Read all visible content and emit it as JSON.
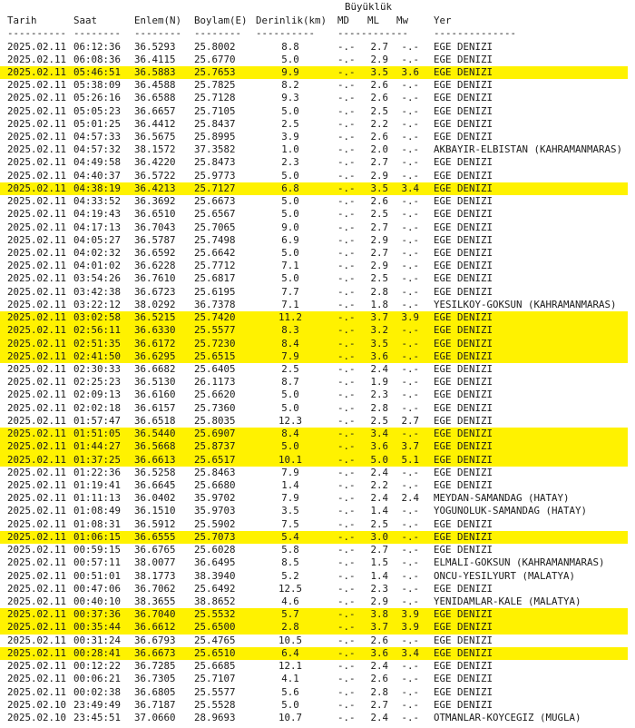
{
  "header": {
    "group_label": "Büyüklük",
    "date": "Tarih",
    "time": "Saat",
    "lat": "Enlem(N)",
    "lon": "Boylam(E)",
    "depth": "Derinlik(km)",
    "md": "MD",
    "ml": "ML",
    "mw": "Mw",
    "loc": "Yer"
  },
  "separators": {
    "date": "----------",
    "time": "--------",
    "lat": "--------",
    "lon": "--------",
    "depth": "----------",
    "mag": "------------",
    "loc": "--------------"
  },
  "highlight_color": "#fff200",
  "rows": [
    {
      "date": "2025.02.11",
      "time": "06:12:36",
      "lat": "36.5293",
      "lon": "25.8002",
      "depth": "8.8",
      "md": "-.-",
      "ml": "2.7",
      "mw": "-.-",
      "loc": "EGE DENIZI",
      "hl": false
    },
    {
      "date": "2025.02.11",
      "time": "06:08:36",
      "lat": "36.4115",
      "lon": "25.6770",
      "depth": "5.0",
      "md": "-.-",
      "ml": "2.9",
      "mw": "-.-",
      "loc": "EGE DENIZI",
      "hl": false
    },
    {
      "date": "2025.02.11",
      "time": "05:46:51",
      "lat": "36.5883",
      "lon": "25.7653",
      "depth": "9.9",
      "md": "-.-",
      "ml": "3.5",
      "mw": "3.6",
      "loc": "EGE DENIZI",
      "hl": true
    },
    {
      "date": "2025.02.11",
      "time": "05:38:09",
      "lat": "36.4588",
      "lon": "25.7825",
      "depth": "8.2",
      "md": "-.-",
      "ml": "2.6",
      "mw": "-.-",
      "loc": "EGE DENIZI",
      "hl": false
    },
    {
      "date": "2025.02.11",
      "time": "05:26:16",
      "lat": "36.6588",
      "lon": "25.7128",
      "depth": "9.3",
      "md": "-.-",
      "ml": "2.6",
      "mw": "-.-",
      "loc": "EGE DENIZI",
      "hl": false
    },
    {
      "date": "2025.02.11",
      "time": "05:05:23",
      "lat": "36.6657",
      "lon": "25.7105",
      "depth": "5.0",
      "md": "-.-",
      "ml": "2.5",
      "mw": "-.-",
      "loc": "EGE DENIZI",
      "hl": false
    },
    {
      "date": "2025.02.11",
      "time": "05:01:25",
      "lat": "36.4412",
      "lon": "25.8437",
      "depth": "2.5",
      "md": "-.-",
      "ml": "2.2",
      "mw": "-.-",
      "loc": "EGE DENIZI",
      "hl": false
    },
    {
      "date": "2025.02.11",
      "time": "04:57:33",
      "lat": "36.5675",
      "lon": "25.8995",
      "depth": "3.9",
      "md": "-.-",
      "ml": "2.6",
      "mw": "-.-",
      "loc": "EGE DENIZI",
      "hl": false
    },
    {
      "date": "2025.02.11",
      "time": "04:57:32",
      "lat": "38.1572",
      "lon": "37.3582",
      "depth": "1.0",
      "md": "-.-",
      "ml": "2.0",
      "mw": "-.-",
      "loc": "AKBAYIR-ELBISTAN (KAHRAMANMARAS)",
      "hl": false
    },
    {
      "date": "2025.02.11",
      "time": "04:49:58",
      "lat": "36.4220",
      "lon": "25.8473",
      "depth": "2.3",
      "md": "-.-",
      "ml": "2.7",
      "mw": "-.-",
      "loc": "EGE DENIZI",
      "hl": false
    },
    {
      "date": "2025.02.11",
      "time": "04:40:37",
      "lat": "36.5722",
      "lon": "25.9773",
      "depth": "5.0",
      "md": "-.-",
      "ml": "2.9",
      "mw": "-.-",
      "loc": "EGE DENIZI",
      "hl": false
    },
    {
      "date": "2025.02.11",
      "time": "04:38:19",
      "lat": "36.4213",
      "lon": "25.7127",
      "depth": "6.8",
      "md": "-.-",
      "ml": "3.5",
      "mw": "3.4",
      "loc": "EGE DENIZI",
      "hl": true
    },
    {
      "date": "2025.02.11",
      "time": "04:33:52",
      "lat": "36.3692",
      "lon": "25.6673",
      "depth": "5.0",
      "md": "-.-",
      "ml": "2.6",
      "mw": "-.-",
      "loc": "EGE DENIZI",
      "hl": false
    },
    {
      "date": "2025.02.11",
      "time": "04:19:43",
      "lat": "36.6510",
      "lon": "25.6567",
      "depth": "5.0",
      "md": "-.-",
      "ml": "2.5",
      "mw": "-.-",
      "loc": "EGE DENIZI",
      "hl": false
    },
    {
      "date": "2025.02.11",
      "time": "04:17:13",
      "lat": "36.7043",
      "lon": "25.7065",
      "depth": "9.0",
      "md": "-.-",
      "ml": "2.7",
      "mw": "-.-",
      "loc": "EGE DENIZI",
      "hl": false
    },
    {
      "date": "2025.02.11",
      "time": "04:05:27",
      "lat": "36.5787",
      "lon": "25.7498",
      "depth": "6.9",
      "md": "-.-",
      "ml": "2.9",
      "mw": "-.-",
      "loc": "EGE DENIZI",
      "hl": false
    },
    {
      "date": "2025.02.11",
      "time": "04:02:32",
      "lat": "36.6592",
      "lon": "25.6642",
      "depth": "5.0",
      "md": "-.-",
      "ml": "2.7",
      "mw": "-.-",
      "loc": "EGE DENIZI",
      "hl": false
    },
    {
      "date": "2025.02.11",
      "time": "04:01:02",
      "lat": "36.6228",
      "lon": "25.7712",
      "depth": "7.1",
      "md": "-.-",
      "ml": "2.9",
      "mw": "-.-",
      "loc": "EGE DENIZI",
      "hl": false
    },
    {
      "date": "2025.02.11",
      "time": "03:54:26",
      "lat": "36.7610",
      "lon": "25.6817",
      "depth": "5.0",
      "md": "-.-",
      "ml": "2.5",
      "mw": "-.-",
      "loc": "EGE DENIZI",
      "hl": false
    },
    {
      "date": "2025.02.11",
      "time": "03:42:38",
      "lat": "36.6723",
      "lon": "25.6195",
      "depth": "7.7",
      "md": "-.-",
      "ml": "2.8",
      "mw": "-.-",
      "loc": "EGE DENIZI",
      "hl": false
    },
    {
      "date": "2025.02.11",
      "time": "03:22:12",
      "lat": "38.0292",
      "lon": "36.7378",
      "depth": "7.1",
      "md": "-.-",
      "ml": "1.8",
      "mw": "-.-",
      "loc": "YESILKOY-GOKSUN (KAHRAMANMARAS)",
      "hl": false
    },
    {
      "date": "2025.02.11",
      "time": "03:02:58",
      "lat": "36.5215",
      "lon": "25.7420",
      "depth": "11.2",
      "md": "-.-",
      "ml": "3.7",
      "mw": "3.9",
      "loc": "EGE DENIZI",
      "hl": true
    },
    {
      "date": "2025.02.11",
      "time": "02:56:11",
      "lat": "36.6330",
      "lon": "25.5577",
      "depth": "8.3",
      "md": "-.-",
      "ml": "3.2",
      "mw": "-.-",
      "loc": "EGE DENIZI",
      "hl": true
    },
    {
      "date": "2025.02.11",
      "time": "02:51:35",
      "lat": "36.6172",
      "lon": "25.7230",
      "depth": "8.4",
      "md": "-.-",
      "ml": "3.5",
      "mw": "-.-",
      "loc": "EGE DENIZI",
      "hl": true
    },
    {
      "date": "2025.02.11",
      "time": "02:41:50",
      "lat": "36.6295",
      "lon": "25.6515",
      "depth": "7.9",
      "md": "-.-",
      "ml": "3.6",
      "mw": "-.-",
      "loc": "EGE DENIZI",
      "hl": true
    },
    {
      "date": "2025.02.11",
      "time": "02:30:33",
      "lat": "36.6682",
      "lon": "25.6405",
      "depth": "2.5",
      "md": "-.-",
      "ml": "2.4",
      "mw": "-.-",
      "loc": "EGE DENIZI",
      "hl": false
    },
    {
      "date": "2025.02.11",
      "time": "02:25:23",
      "lat": "36.5130",
      "lon": "26.1173",
      "depth": "8.7",
      "md": "-.-",
      "ml": "1.9",
      "mw": "-.-",
      "loc": "EGE DENIZI",
      "hl": false
    },
    {
      "date": "2025.02.11",
      "time": "02:09:13",
      "lat": "36.6160",
      "lon": "25.6620",
      "depth": "5.0",
      "md": "-.-",
      "ml": "2.3",
      "mw": "-.-",
      "loc": "EGE DENIZI",
      "hl": false
    },
    {
      "date": "2025.02.11",
      "time": "02:02:18",
      "lat": "36.6157",
      "lon": "25.7360",
      "depth": "5.0",
      "md": "-.-",
      "ml": "2.8",
      "mw": "-.-",
      "loc": "EGE DENIZI",
      "hl": false
    },
    {
      "date": "2025.02.11",
      "time": "01:57:47",
      "lat": "36.6518",
      "lon": "25.8035",
      "depth": "12.3",
      "md": "-.-",
      "ml": "2.5",
      "mw": "2.7",
      "loc": "EGE DENIZI",
      "hl": false
    },
    {
      "date": "2025.02.11",
      "time": "01:51:05",
      "lat": "36.5440",
      "lon": "25.6907",
      "depth": "8.4",
      "md": "-.-",
      "ml": "3.4",
      "mw": "-.-",
      "loc": "EGE DENIZI",
      "hl": true
    },
    {
      "date": "2025.02.11",
      "time": "01:44:27",
      "lat": "36.5668",
      "lon": "25.8737",
      "depth": "5.0",
      "md": "-.-",
      "ml": "3.6",
      "mw": "3.7",
      "loc": "EGE DENIZI",
      "hl": true
    },
    {
      "date": "2025.02.11",
      "time": "01:37:25",
      "lat": "36.6613",
      "lon": "25.6517",
      "depth": "10.1",
      "md": "-.-",
      "ml": "5.0",
      "mw": "5.1",
      "loc": "EGE DENIZI",
      "hl": true
    },
    {
      "date": "2025.02.11",
      "time": "01:22:36",
      "lat": "36.5258",
      "lon": "25.8463",
      "depth": "7.9",
      "md": "-.-",
      "ml": "2.4",
      "mw": "-.-",
      "loc": "EGE DENIZI",
      "hl": false
    },
    {
      "date": "2025.02.11",
      "time": "01:19:41",
      "lat": "36.6645",
      "lon": "25.6680",
      "depth": "1.4",
      "md": "-.-",
      "ml": "2.2",
      "mw": "-.-",
      "loc": "EGE DENIZI",
      "hl": false
    },
    {
      "date": "2025.02.11",
      "time": "01:11:13",
      "lat": "36.0402",
      "lon": "35.9702",
      "depth": "7.9",
      "md": "-.-",
      "ml": "2.4",
      "mw": "2.4",
      "loc": "MEYDAN-SAMANDAG (HATAY)",
      "hl": false
    },
    {
      "date": "2025.02.11",
      "time": "01:08:49",
      "lat": "36.1510",
      "lon": "35.9703",
      "depth": "3.5",
      "md": "-.-",
      "ml": "1.4",
      "mw": "-.-",
      "loc": "YOGUNOLUK-SAMANDAG (HATAY)",
      "hl": false
    },
    {
      "date": "2025.02.11",
      "time": "01:08:31",
      "lat": "36.5912",
      "lon": "25.5902",
      "depth": "7.5",
      "md": "-.-",
      "ml": "2.5",
      "mw": "-.-",
      "loc": "EGE DENIZI",
      "hl": false
    },
    {
      "date": "2025.02.11",
      "time": "01:06:15",
      "lat": "36.6555",
      "lon": "25.7073",
      "depth": "5.4",
      "md": "-.-",
      "ml": "3.0",
      "mw": "-.-",
      "loc": "EGE DENIZI",
      "hl": true
    },
    {
      "date": "2025.02.11",
      "time": "00:59:15",
      "lat": "36.6765",
      "lon": "25.6028",
      "depth": "5.8",
      "md": "-.-",
      "ml": "2.7",
      "mw": "-.-",
      "loc": "EGE DENIZI",
      "hl": false
    },
    {
      "date": "2025.02.11",
      "time": "00:57:11",
      "lat": "38.0077",
      "lon": "36.6495",
      "depth": "8.5",
      "md": "-.-",
      "ml": "1.5",
      "mw": "-.-",
      "loc": "ELMALI-GOKSUN (KAHRAMANMARAS)",
      "hl": false
    },
    {
      "date": "2025.02.11",
      "time": "00:51:01",
      "lat": "38.1773",
      "lon": "38.3940",
      "depth": "5.2",
      "md": "-.-",
      "ml": "1.4",
      "mw": "-.-",
      "loc": "ONCU-YESILYURT (MALATYA)",
      "hl": false
    },
    {
      "date": "2025.02.11",
      "time": "00:47:06",
      "lat": "36.7062",
      "lon": "25.6492",
      "depth": "12.5",
      "md": "-.-",
      "ml": "2.3",
      "mw": "-.-",
      "loc": "EGE DENIZI",
      "hl": false
    },
    {
      "date": "2025.02.11",
      "time": "00:40:10",
      "lat": "38.3655",
      "lon": "38.8652",
      "depth": "4.6",
      "md": "-.-",
      "ml": "2.9",
      "mw": "-.-",
      "loc": "YENIDAMLAR-KALE (MALATYA)",
      "hl": false
    },
    {
      "date": "2025.02.11",
      "time": "00:37:36",
      "lat": "36.7040",
      "lon": "25.5532",
      "depth": "5.7",
      "md": "-.-",
      "ml": "3.8",
      "mw": "3.9",
      "loc": "EGE DENIZI",
      "hl": true
    },
    {
      "date": "2025.02.11",
      "time": "00:35:44",
      "lat": "36.6612",
      "lon": "25.6500",
      "depth": "2.8",
      "md": "-.-",
      "ml": "3.7",
      "mw": "3.9",
      "loc": "EGE DENIZI",
      "hl": true
    },
    {
      "date": "2025.02.11",
      "time": "00:31:24",
      "lat": "36.6793",
      "lon": "25.4765",
      "depth": "10.5",
      "md": "-.-",
      "ml": "2.6",
      "mw": "-.-",
      "loc": "EGE DENIZI",
      "hl": false
    },
    {
      "date": "2025.02.11",
      "time": "00:28:41",
      "lat": "36.6673",
      "lon": "25.6510",
      "depth": "6.4",
      "md": "-.-",
      "ml": "3.6",
      "mw": "3.4",
      "loc": "EGE DENIZI",
      "hl": true
    },
    {
      "date": "2025.02.11",
      "time": "00:12:22",
      "lat": "36.7285",
      "lon": "25.6685",
      "depth": "12.1",
      "md": "-.-",
      "ml": "2.4",
      "mw": "-.-",
      "loc": "EGE DENIZI",
      "hl": false
    },
    {
      "date": "2025.02.11",
      "time": "00:06:21",
      "lat": "36.7305",
      "lon": "25.7107",
      "depth": "4.1",
      "md": "-.-",
      "ml": "2.6",
      "mw": "-.-",
      "loc": "EGE DENIZI",
      "hl": false
    },
    {
      "date": "2025.02.11",
      "time": "00:02:38",
      "lat": "36.6805",
      "lon": "25.5577",
      "depth": "5.6",
      "md": "-.-",
      "ml": "2.8",
      "mw": "-.-",
      "loc": "EGE DENIZI",
      "hl": false
    },
    {
      "date": "2025.02.10",
      "time": "23:49:49",
      "lat": "36.7187",
      "lon": "25.5528",
      "depth": "5.0",
      "md": "-.-",
      "ml": "2.7",
      "mw": "-.-",
      "loc": "EGE DENIZI",
      "hl": false
    },
    {
      "date": "2025.02.10",
      "time": "23:45:51",
      "lat": "37.0660",
      "lon": "28.9693",
      "depth": "10.7",
      "md": "-.-",
      "ml": "2.4",
      "mw": "-.-",
      "loc": "OTMANLAR-KOYCEGIZ (MUGLA)",
      "hl": false
    }
  ]
}
